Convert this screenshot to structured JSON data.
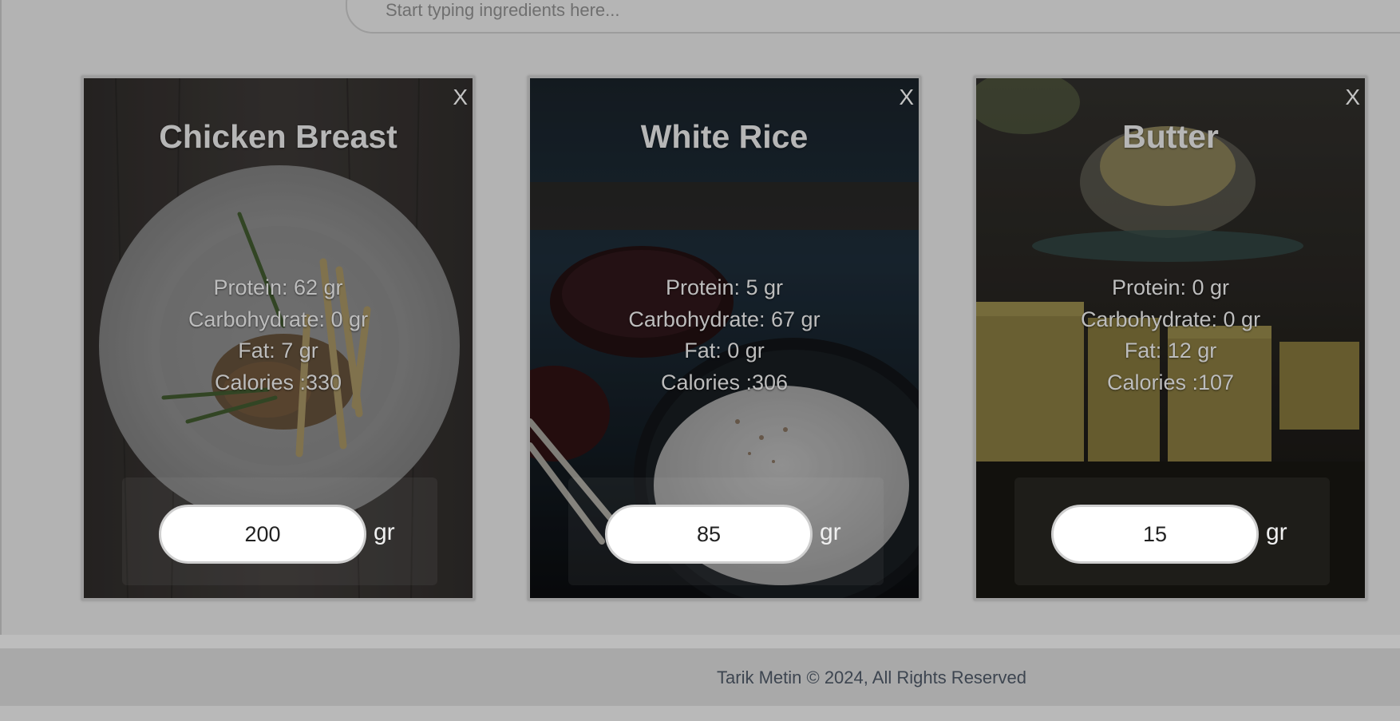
{
  "search": {
    "placeholder": "Start typing ingredients here..."
  },
  "cards": [
    {
      "title": "Chicken Breast",
      "close_label": "X",
      "protein": "Protein: 62 gr",
      "carbohydrate": "Carbohydrate: 0 gr",
      "fat": "Fat: 7 gr",
      "calories": "Calories :330",
      "quantity": "200",
      "unit": "gr"
    },
    {
      "title": "White Rice",
      "close_label": "X",
      "protein": "Protein: 5 gr",
      "carbohydrate": "Carbohydrate: 67 gr",
      "fat": "Fat: 0 gr",
      "calories": "Calories :306",
      "quantity": "85",
      "unit": "gr"
    },
    {
      "title": "Butter",
      "close_label": "X",
      "protein": "Protein: 0 gr",
      "carbohydrate": "Carbohydrate: 0 gr",
      "fat": "Fat: 12 gr",
      "calories": "Calories :107",
      "quantity": "15",
      "unit": "gr"
    }
  ],
  "footer": {
    "text": "Tarik Metin © 2024, All Rights Reserved"
  },
  "colors": {
    "page_background": "#b3b3b3",
    "footer_background": "#a9a9a9",
    "footer_text": "#3d4550",
    "input_background": "#ffffff"
  }
}
